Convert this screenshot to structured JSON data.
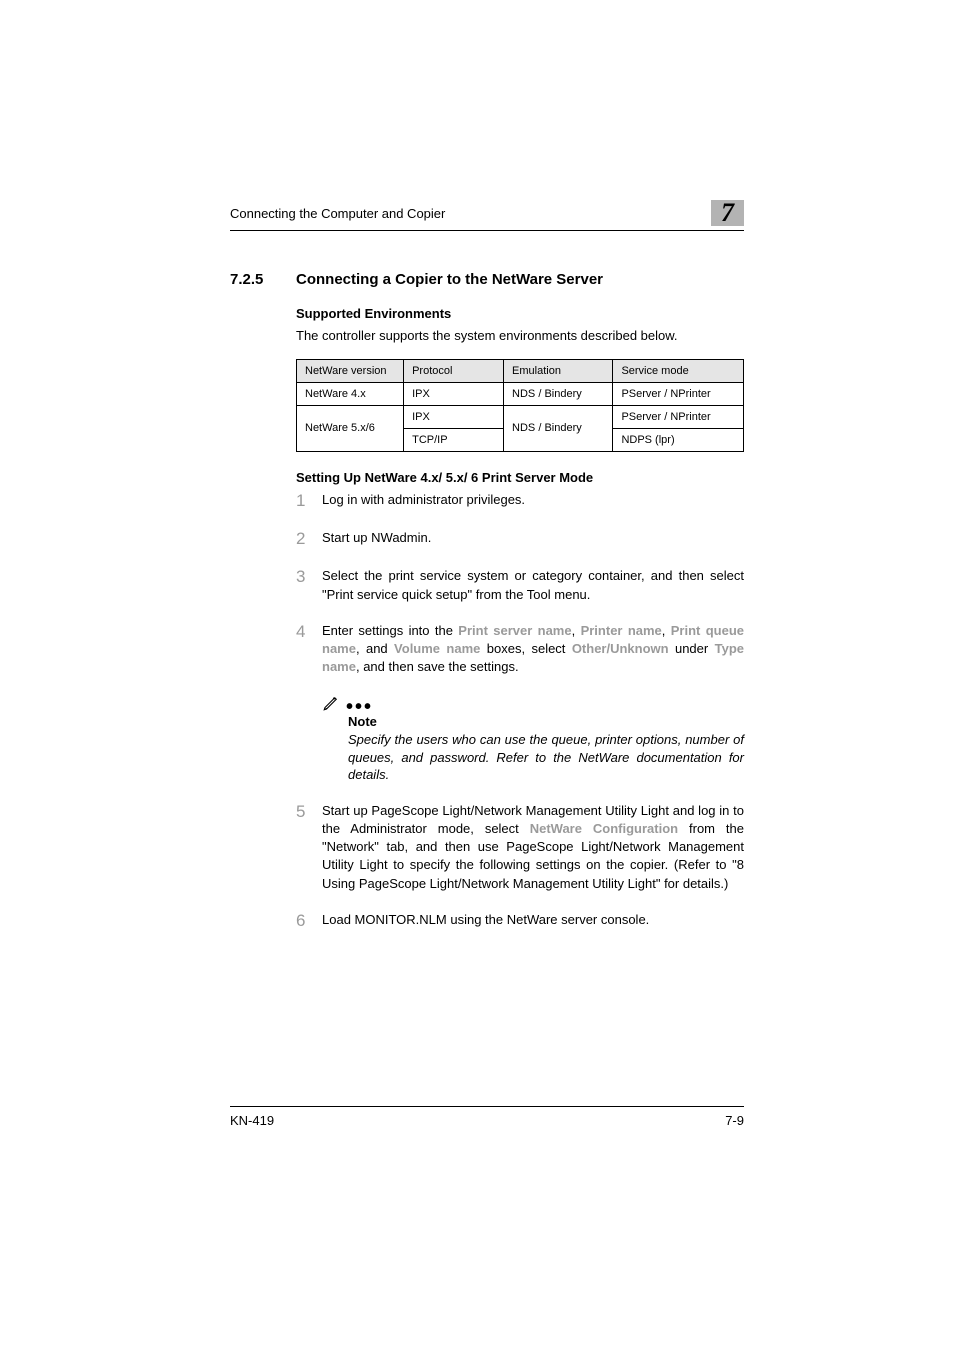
{
  "header": {
    "running_head": "Connecting the Computer and Copier",
    "chapter_number": "7"
  },
  "section": {
    "number": "7.2.5",
    "title": "Connecting a Copier to the NetWare Server",
    "supported_head": "Supported Environments",
    "supported_intro": "The controller supports the system environments described below.",
    "table": {
      "headers": {
        "version": "NetWare version",
        "protocol": "Protocol",
        "emulation": "Emulation",
        "service": "Service mode"
      },
      "rows": [
        {
          "version": "NetWare 4.x",
          "protocol": "IPX",
          "emulation": "NDS / Bindery",
          "service": "PServer / NPrinter"
        },
        {
          "version": "NetWare 5.x/6",
          "protocol": "IPX",
          "emulation": "NDS / Bindery",
          "service": "PServer / NPrinter"
        },
        {
          "version": "",
          "protocol": "TCP/IP",
          "emulation": "",
          "service": "NDPS (lpr)"
        }
      ]
    },
    "setup_head": "Setting Up NetWare 4.x/ 5.x/ 6 Print Server Mode",
    "steps": {
      "s1": "Log in with administrator privileges.",
      "s2": "Start up NWadmin.",
      "s3": "Select the print service system or category container, and then select \"Print service quick setup\" from the Tool menu.",
      "s4": {
        "pre": "Enter settings into the ",
        "l1": "Print server name",
        "c1": ", ",
        "l2": "Printer name",
        "c2": ", ",
        "l3": "Print queue name",
        "c3": ", and ",
        "l4": "Volume name",
        "c4": " boxes, select ",
        "l5": "Other/Unknown",
        "c5": " under ",
        "l6": "Type name",
        "post": ", and then save the settings."
      },
      "s5": {
        "pre": "Start up PageScope Light/Network Management Utility Light and log in to the Administrator mode, select ",
        "l1": "NetWare Configuration",
        "post": " from the \"Network\" tab, and then use PageScope Light/Network Management Utility Light to specify the following settings on the copier. (Refer to \"8 Using PageScope Light/Network Management Utility Light\" for details.)"
      },
      "s6": "Load MONITOR.NLM using the NetWare server console."
    },
    "note": {
      "label": "Note",
      "text": "Specify the users who can use the queue, printer options, number of queues, and password. Refer to the NetWare documentation for details."
    }
  },
  "footer": {
    "doc": "KN-419",
    "page": "7-9"
  }
}
